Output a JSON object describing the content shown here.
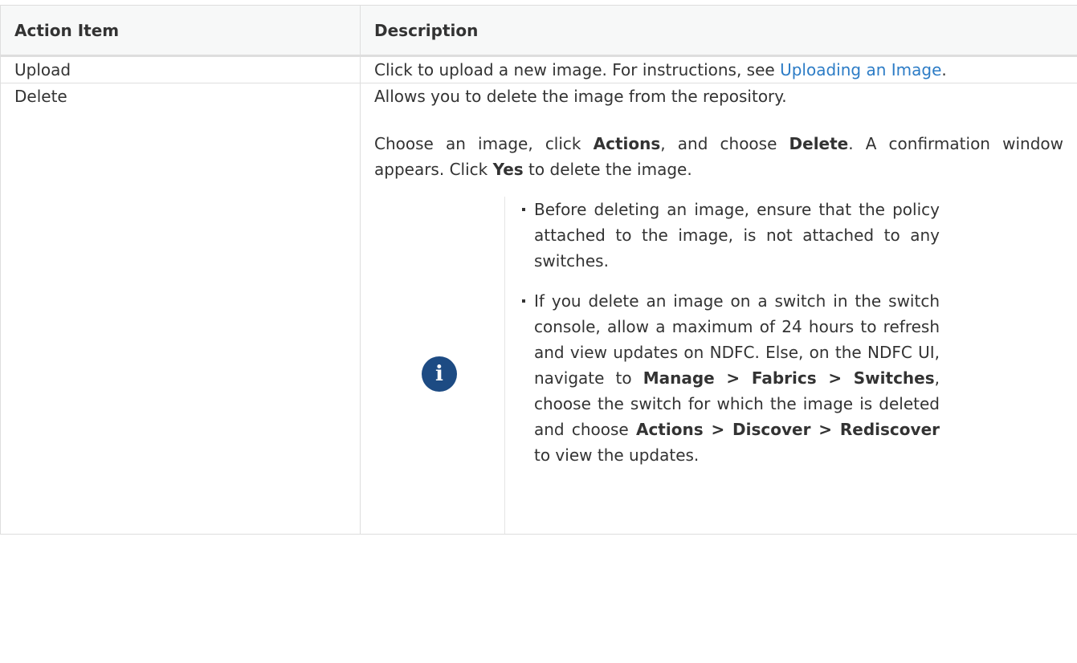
{
  "table": {
    "headers": [
      "Action Item",
      "Description"
    ],
    "rows": [
      {
        "action": "Upload",
        "desc_prefix": "Click to upload a new image. For instructions, see ",
        "link_text": "Uploading an Image",
        "desc_suffix": "."
      },
      {
        "action": "Delete",
        "para1": "Allows you to delete the image from the repository.",
        "para2": {
          "t1": "Choose an image, click ",
          "b1": "Actions",
          "t2": ", and choose ",
          "b2": "Delete",
          "t3": ". A confirmation window appears. Click ",
          "b3": "Yes",
          "t4": " to delete the image."
        },
        "note": {
          "icon": "info-icon",
          "bullet1": "Before deleting an image, ensure that the policy attached to the image, is not attached to any switches.",
          "bullet2": {
            "t1": "If you delete an image on a switch in the switch console, allow a maximum of 24 hours to refresh and view updates on NDFC. Else, on the NDFC UI, navigate to ",
            "b1": "Manage > Fabrics > Switches",
            "t2": ", choose the switch for which the image is deleted and choose ",
            "b2": "Actions > Discover > Rediscover",
            "t3": " to view the updates."
          }
        }
      }
    ]
  },
  "colors": {
    "link": "#2c7cc6",
    "icon_bg": "#1d4b83",
    "header_bg": "#f7f8f8",
    "border": "#dedede"
  }
}
